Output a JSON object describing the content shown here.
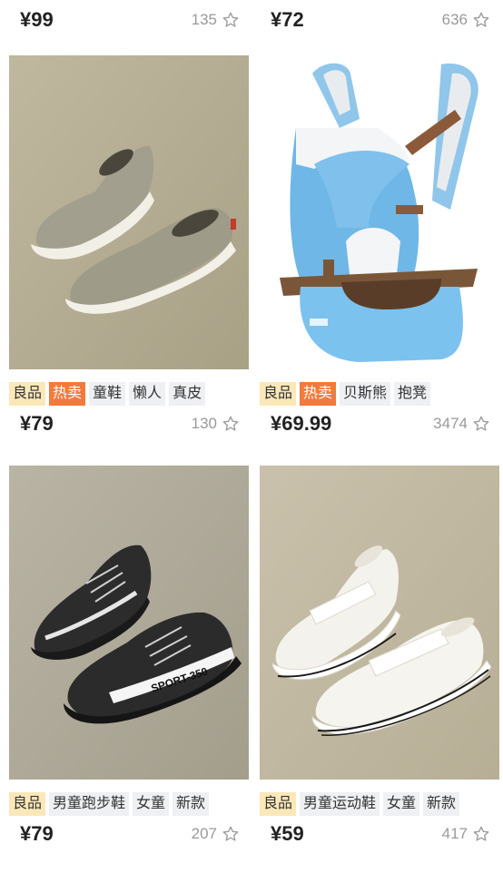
{
  "top_row": [
    {
      "price": "¥99",
      "likes": "135"
    },
    {
      "price": "¥72",
      "likes": "636"
    }
  ],
  "products": [
    {
      "image": "gray suede slip-on kids shoes",
      "tags": [
        {
          "label": "良品",
          "type": "good"
        },
        {
          "label": "热卖",
          "type": "hot"
        },
        {
          "label": "童鞋",
          "type": "normal"
        },
        {
          "label": "懒人",
          "type": "normal"
        },
        {
          "label": "真皮",
          "type": "normal"
        }
      ],
      "price": "¥79",
      "likes": "130"
    },
    {
      "image": "light blue baby carrier with hip seat",
      "tags": [
        {
          "label": "良品",
          "type": "good"
        },
        {
          "label": "热卖",
          "type": "hot"
        },
        {
          "label": "贝斯熊",
          "type": "normal"
        },
        {
          "label": "抱凳",
          "type": "normal"
        }
      ],
      "price": "¥69.99",
      "likes": "3474"
    },
    {
      "image": "black knit running sneakers with SPORT-350 stripe",
      "shoe_text": "SPORT-350",
      "tags": [
        {
          "label": "良品",
          "type": "good"
        },
        {
          "label": "男童跑步鞋",
          "type": "normal"
        },
        {
          "label": "女童",
          "type": "normal"
        },
        {
          "label": "新款",
          "type": "normal"
        }
      ],
      "price": "¥79",
      "likes": "207"
    },
    {
      "image": "white velcro kids sneakers",
      "tags": [
        {
          "label": "良品",
          "type": "good"
        },
        {
          "label": "男童运动鞋",
          "type": "normal"
        },
        {
          "label": "女童",
          "type": "normal"
        },
        {
          "label": "新款",
          "type": "normal"
        }
      ],
      "price": "¥59",
      "likes": "417"
    }
  ],
  "icons": {
    "like": "star-outline-icon"
  },
  "colors": {
    "hot_tag": "#f27a3c",
    "good_tag": "#fbe8b8",
    "tag_bg": "#eef0f3",
    "price": "#222222",
    "likes": "#9a9a9a"
  }
}
